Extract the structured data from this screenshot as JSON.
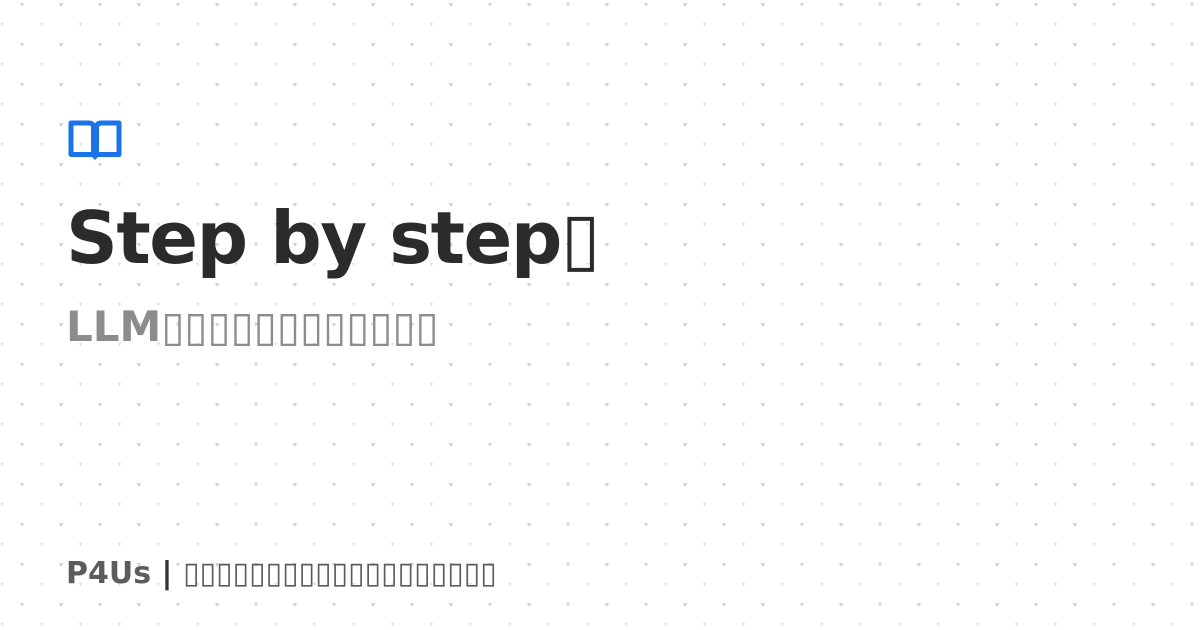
{
  "card": {
    "title": "Step by step▯",
    "subtitle": "LLM▯▯▯▯▯▯▯▯▯▯▯▯",
    "footer_site": "P4Us",
    "footer_separator": " | ",
    "footer_tagline": "▯▯▯▯▯▯▯▯▯▯▯▯▯▯▯▯▯▯▯",
    "icon": "book-open-icon"
  },
  "colors": {
    "accent": "#1a73e8",
    "title": "#2b2b2b",
    "subtitle": "#8c8c8c",
    "footer": "#5c5c5c",
    "pattern": "#cfcfcf",
    "background": "#ffffff"
  }
}
